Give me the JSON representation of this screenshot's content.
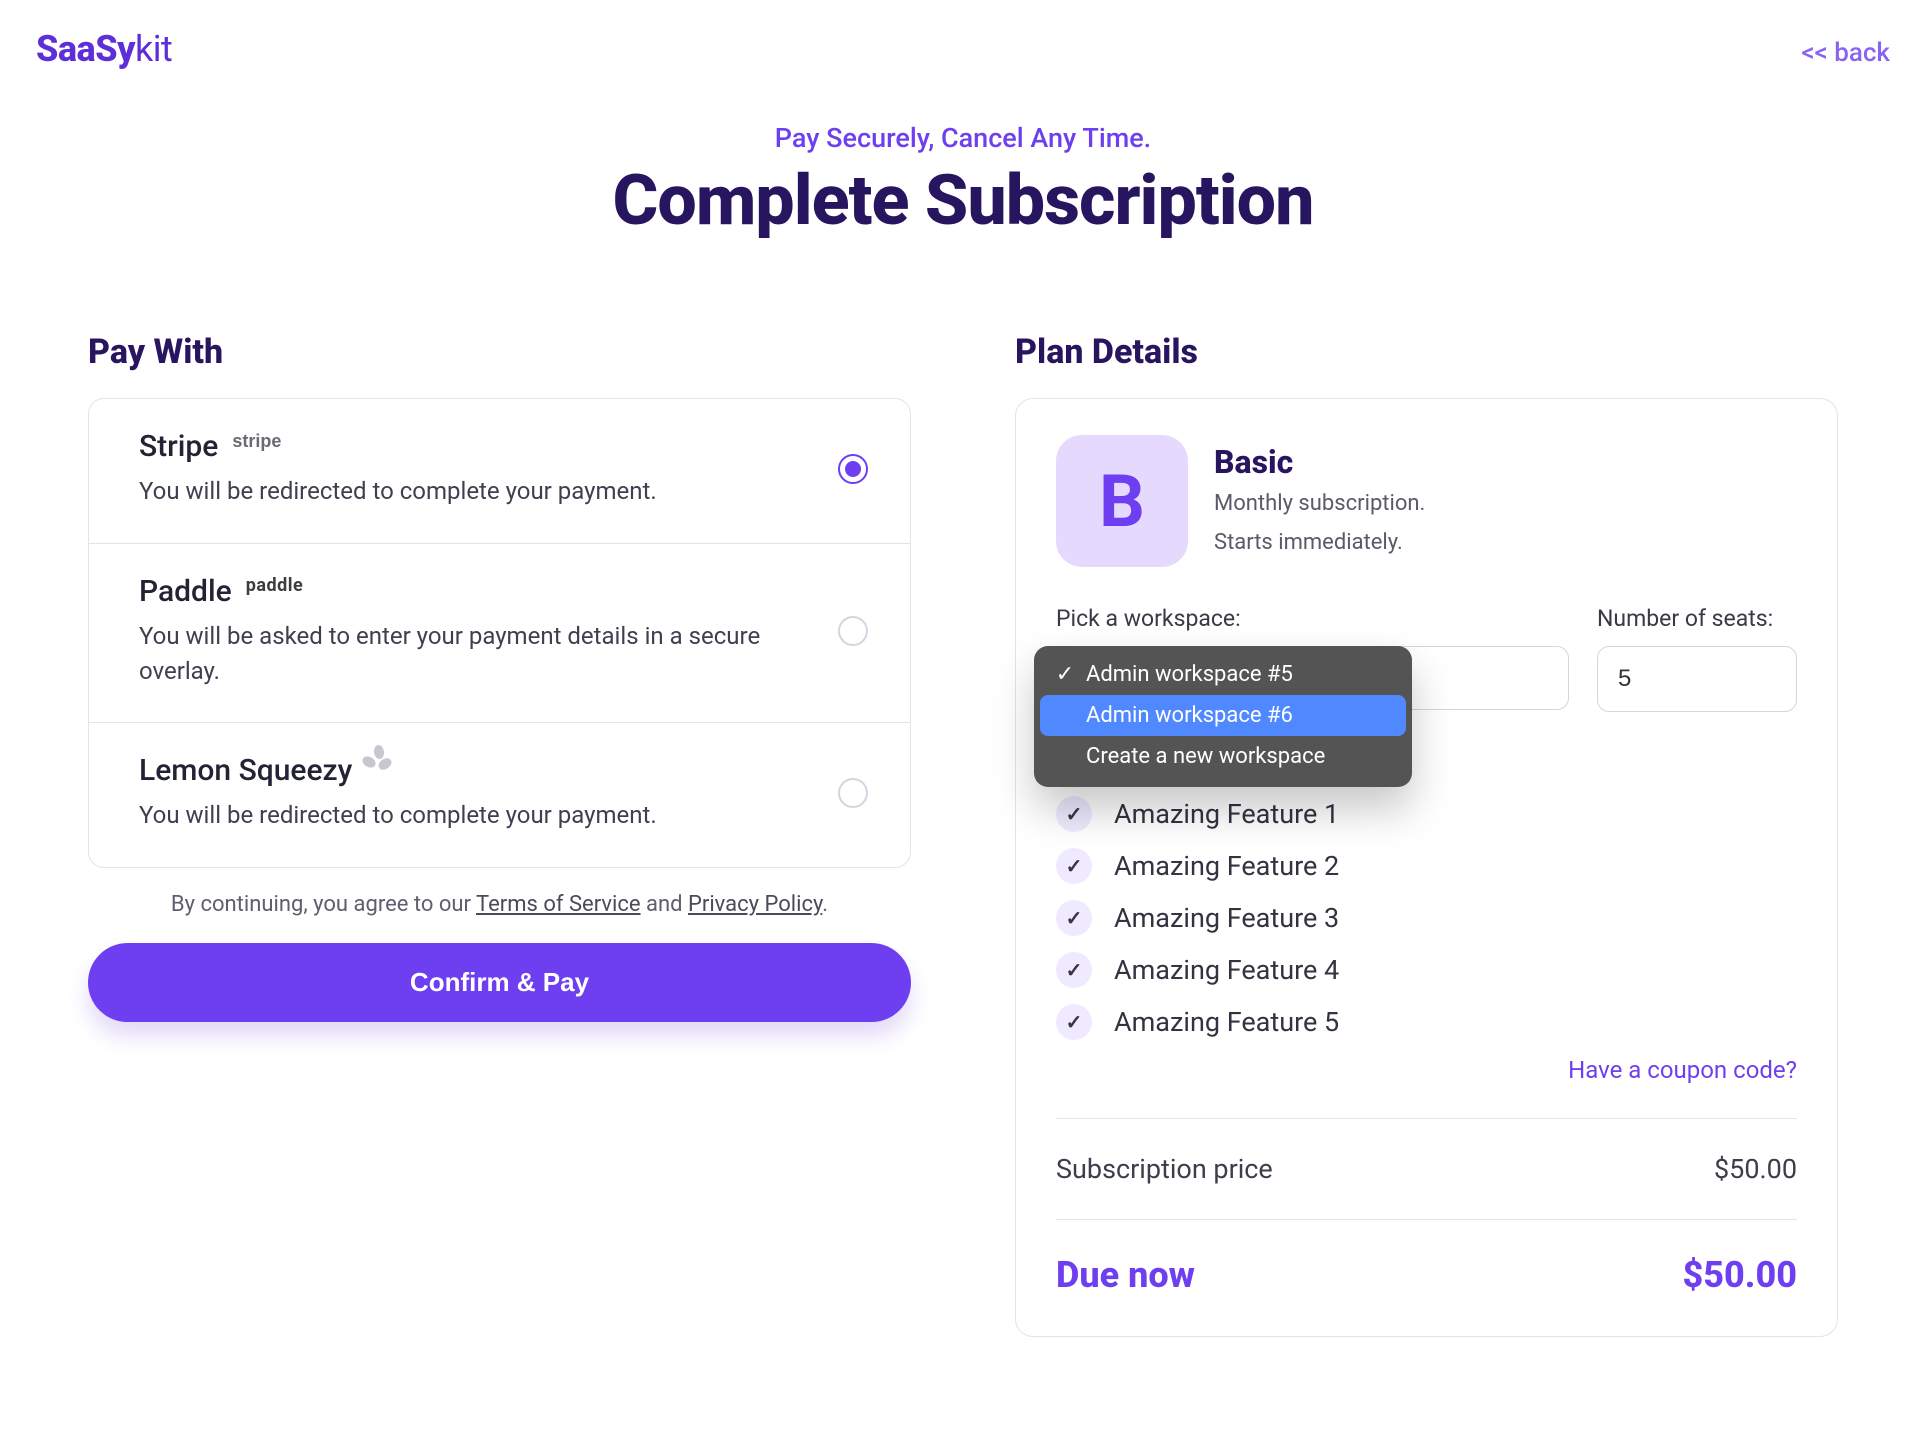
{
  "brand": {
    "bold": "SaaSy",
    "light": "kit"
  },
  "back": {
    "label": "<< back"
  },
  "hero": {
    "kicker": "Pay Securely, Cancel Any Time.",
    "title": "Complete Subscription"
  },
  "left": {
    "heading": "Pay With",
    "methods": [
      {
        "id": "stripe",
        "title": "Stripe",
        "mark": "stripe",
        "desc": "You will be redirected to complete your payment.",
        "selected": true
      },
      {
        "id": "paddle",
        "title": "Paddle",
        "mark": "paddle",
        "desc": "You will be asked to enter your payment details in a secure overlay.",
        "selected": false
      },
      {
        "id": "lemon",
        "title": "Lemon Squeezy",
        "mark": "",
        "desc": "You will be redirected to complete your payment.",
        "selected": false
      }
    ],
    "agree": {
      "pre": "By continuing, you agree to our ",
      "tos": "Terms of Service",
      "mid": " and ",
      "privacy": "Privacy Policy",
      "post": "."
    },
    "cta": "Confirm & Pay"
  },
  "right": {
    "heading": "Plan Details",
    "plan": {
      "badge": "B",
      "name": "Basic",
      "sub1": "Monthly subscription.",
      "sub2": "Starts immediately."
    },
    "workspace": {
      "label": "Pick a workspace:",
      "options": [
        {
          "label": "Admin workspace #5",
          "selected": true,
          "highlighted": false
        },
        {
          "label": "Admin workspace #6",
          "selected": false,
          "highlighted": true
        },
        {
          "label": "Create a new workspace",
          "selected": false,
          "highlighted": false
        }
      ]
    },
    "seats": {
      "label": "Number of seats:",
      "value": "5"
    },
    "features": [
      "Amazing Feature 1",
      "Amazing Feature 2",
      "Amazing Feature 3",
      "Amazing Feature 4",
      "Amazing Feature 5"
    ],
    "coupon": "Have a coupon code?",
    "price": {
      "label": "Subscription price",
      "value": "$50.00"
    },
    "due": {
      "label": "Due now",
      "value": "$50.00"
    }
  }
}
